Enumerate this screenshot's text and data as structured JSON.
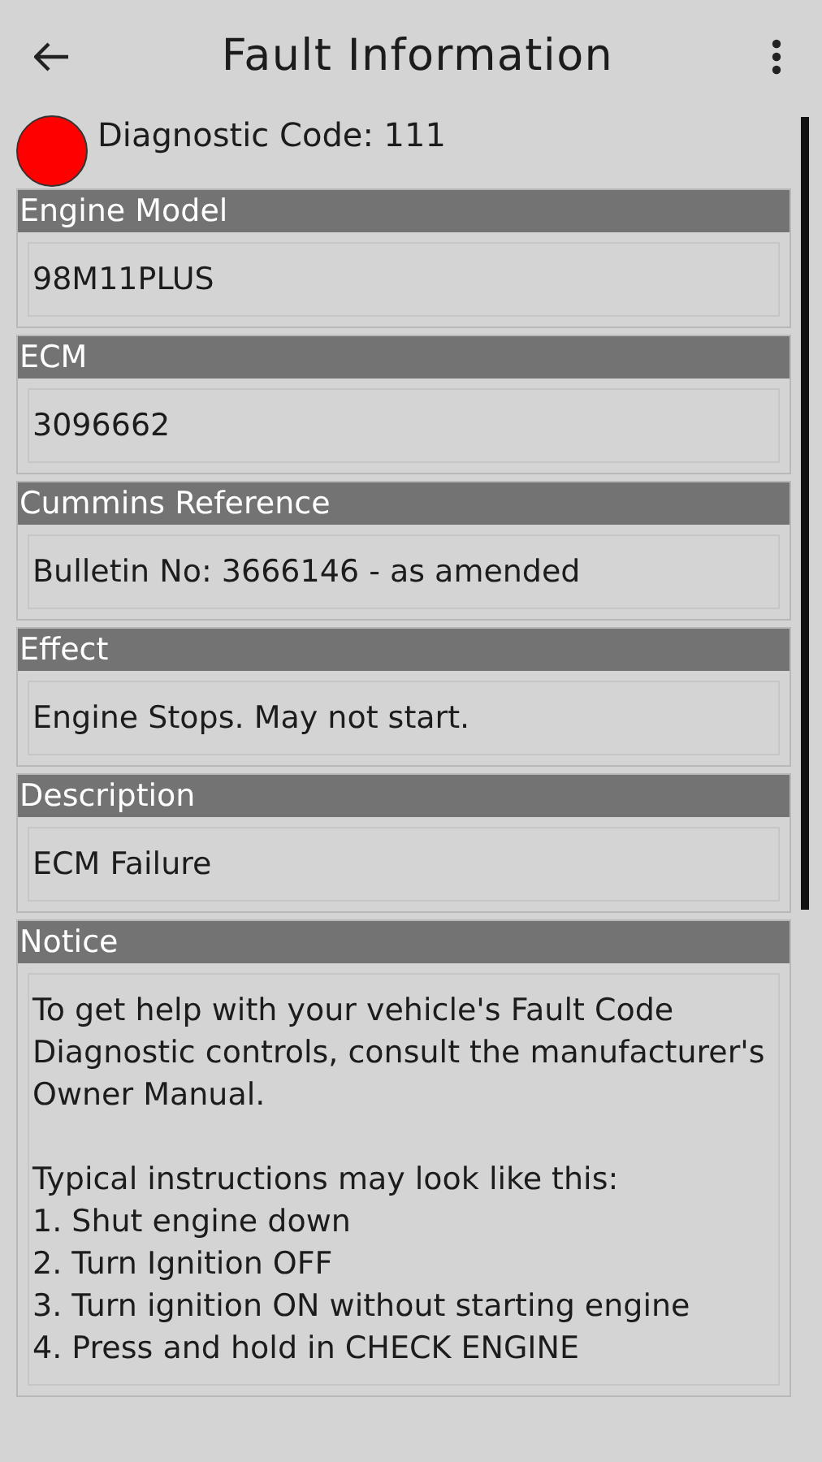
{
  "app_bar": {
    "title": "Fault Information"
  },
  "diagnostic_code": "Diagnostic Code: 111",
  "sections": [
    {
      "heading": "Engine Model",
      "value": "98M11PLUS"
    },
    {
      "heading": "ECM",
      "value": "3096662"
    },
    {
      "heading": "Cummins Reference",
      "value": "Bulletin No: 3666146 - as amended"
    },
    {
      "heading": "Effect",
      "value": "Engine Stops. May not start."
    },
    {
      "heading": "Description",
      "value": "ECM Failure"
    },
    {
      "heading": "Notice",
      "value": "To get help with your vehicle's Fault Code Diagnostic controls, consult the manufacturer's Owner Manual.\n\nTypical instructions may look like this:\n1. Shut engine down\n2. Turn Ignition OFF\n3. Turn ignition ON without starting engine\n4. Press and hold in CHECK ENGINE"
    }
  ]
}
